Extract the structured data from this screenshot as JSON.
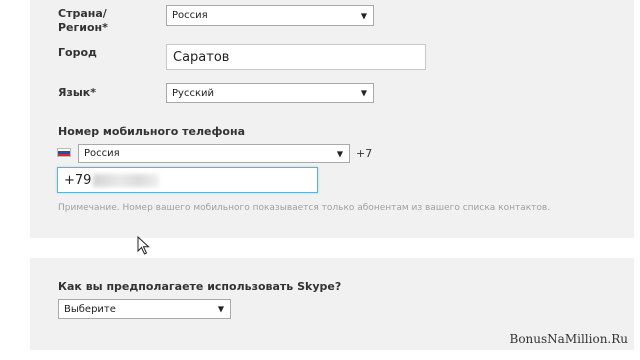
{
  "form": {
    "country_label_line1": "Страна/",
    "country_label_line2": "Регион*",
    "country_value": "Россия",
    "city_label": "Город",
    "city_value": "Саратов",
    "language_label": "Язык*",
    "language_value": "Русский",
    "mobile_label": "Номер мобильного телефона",
    "mobile_country_value": "Россия",
    "mobile_code": "+7",
    "mobile_value": "+79",
    "mobile_note": "Примечание. Номер вашего мобильного показывается только абонентам из вашего списка контактов."
  },
  "usage": {
    "question": "Как вы предполагаете использовать Skype?",
    "select_value": "Выберите"
  },
  "watermark": "BonusNaMillion.Ru",
  "icons": {
    "flag": "russia-flag-icon",
    "cursor": "mouse-pointer-icon",
    "dropdown": "triangle-down-icon"
  },
  "colors": {
    "panel_bg": "#f1f1f1",
    "focus_border": "#5fb1d8",
    "note_text": "#a0a0a0"
  }
}
